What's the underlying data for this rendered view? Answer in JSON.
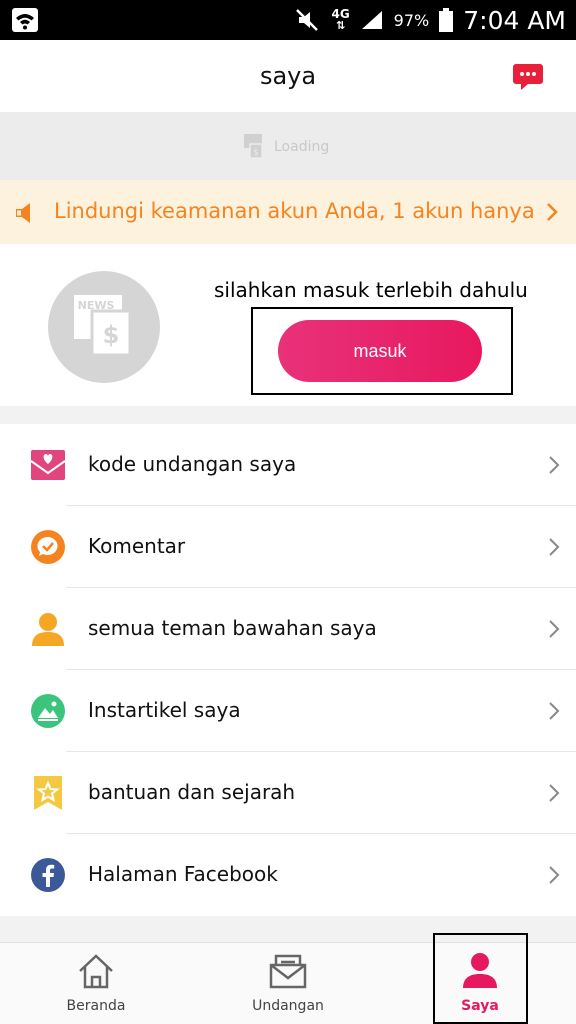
{
  "status_bar": {
    "network": "4G",
    "battery": "97%",
    "time": "7:04 AM"
  },
  "header": {
    "title": "saya",
    "chat_icon": "chat-bubble-icon"
  },
  "ad": {
    "loading_text": "Loading"
  },
  "notice": {
    "text": "Lindungi keamanan akun Anda, 1 akun hanya",
    "color": "#f5831f",
    "background": "#fdf2dd"
  },
  "login": {
    "prompt": "silahkan masuk terlebih dahulu",
    "button_label": "masuk",
    "avatar_badge": "NEWS",
    "accent": "#e8185e"
  },
  "menu": {
    "items": [
      {
        "label": "kode undangan saya",
        "icon": "invite-envelope-icon",
        "color": "#e0457b"
      },
      {
        "label": "Komentar",
        "icon": "comment-icon",
        "color": "#f5831f"
      },
      {
        "label": "semua teman bawahan saya",
        "icon": "person-icon",
        "color": "#f5a623"
      },
      {
        "label": "Instartikel saya",
        "icon": "image-icon",
        "color": "#3cc47c"
      },
      {
        "label": "bantuan dan sejarah",
        "icon": "star-badge-icon",
        "color": "#f5c842"
      },
      {
        "label": "Halaman Facebook",
        "icon": "facebook-icon",
        "color": "#3b5998"
      }
    ]
  },
  "tabbar": {
    "tabs": [
      {
        "label": "Beranda",
        "icon": "home-icon",
        "active": false
      },
      {
        "label": "Undangan",
        "icon": "mail-icon",
        "active": false
      },
      {
        "label": "Saya",
        "icon": "user-icon",
        "active": true
      }
    ]
  }
}
